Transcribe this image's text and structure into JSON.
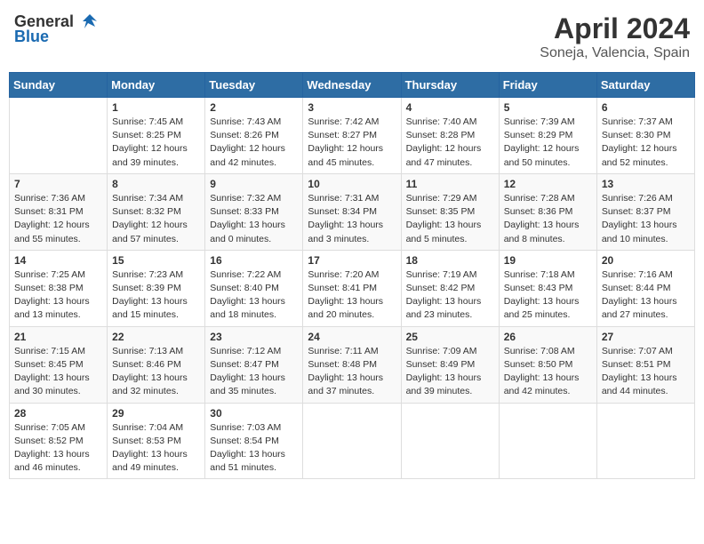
{
  "header": {
    "logo_general": "General",
    "logo_blue": "Blue",
    "month_title": "April 2024",
    "subtitle": "Soneja, Valencia, Spain"
  },
  "days_of_week": [
    "Sunday",
    "Monday",
    "Tuesday",
    "Wednesday",
    "Thursday",
    "Friday",
    "Saturday"
  ],
  "weeks": [
    [
      {
        "day": "",
        "sunrise": "",
        "sunset": "",
        "daylight": ""
      },
      {
        "day": "1",
        "sunrise": "Sunrise: 7:45 AM",
        "sunset": "Sunset: 8:25 PM",
        "daylight": "Daylight: 12 hours and 39 minutes."
      },
      {
        "day": "2",
        "sunrise": "Sunrise: 7:43 AM",
        "sunset": "Sunset: 8:26 PM",
        "daylight": "Daylight: 12 hours and 42 minutes."
      },
      {
        "day": "3",
        "sunrise": "Sunrise: 7:42 AM",
        "sunset": "Sunset: 8:27 PM",
        "daylight": "Daylight: 12 hours and 45 minutes."
      },
      {
        "day": "4",
        "sunrise": "Sunrise: 7:40 AM",
        "sunset": "Sunset: 8:28 PM",
        "daylight": "Daylight: 12 hours and 47 minutes."
      },
      {
        "day": "5",
        "sunrise": "Sunrise: 7:39 AM",
        "sunset": "Sunset: 8:29 PM",
        "daylight": "Daylight: 12 hours and 50 minutes."
      },
      {
        "day": "6",
        "sunrise": "Sunrise: 7:37 AM",
        "sunset": "Sunset: 8:30 PM",
        "daylight": "Daylight: 12 hours and 52 minutes."
      }
    ],
    [
      {
        "day": "7",
        "sunrise": "Sunrise: 7:36 AM",
        "sunset": "Sunset: 8:31 PM",
        "daylight": "Daylight: 12 hours and 55 minutes."
      },
      {
        "day": "8",
        "sunrise": "Sunrise: 7:34 AM",
        "sunset": "Sunset: 8:32 PM",
        "daylight": "Daylight: 12 hours and 57 minutes."
      },
      {
        "day": "9",
        "sunrise": "Sunrise: 7:32 AM",
        "sunset": "Sunset: 8:33 PM",
        "daylight": "Daylight: 13 hours and 0 minutes."
      },
      {
        "day": "10",
        "sunrise": "Sunrise: 7:31 AM",
        "sunset": "Sunset: 8:34 PM",
        "daylight": "Daylight: 13 hours and 3 minutes."
      },
      {
        "day": "11",
        "sunrise": "Sunrise: 7:29 AM",
        "sunset": "Sunset: 8:35 PM",
        "daylight": "Daylight: 13 hours and 5 minutes."
      },
      {
        "day": "12",
        "sunrise": "Sunrise: 7:28 AM",
        "sunset": "Sunset: 8:36 PM",
        "daylight": "Daylight: 13 hours and 8 minutes."
      },
      {
        "day": "13",
        "sunrise": "Sunrise: 7:26 AM",
        "sunset": "Sunset: 8:37 PM",
        "daylight": "Daylight: 13 hours and 10 minutes."
      }
    ],
    [
      {
        "day": "14",
        "sunrise": "Sunrise: 7:25 AM",
        "sunset": "Sunset: 8:38 PM",
        "daylight": "Daylight: 13 hours and 13 minutes."
      },
      {
        "day": "15",
        "sunrise": "Sunrise: 7:23 AM",
        "sunset": "Sunset: 8:39 PM",
        "daylight": "Daylight: 13 hours and 15 minutes."
      },
      {
        "day": "16",
        "sunrise": "Sunrise: 7:22 AM",
        "sunset": "Sunset: 8:40 PM",
        "daylight": "Daylight: 13 hours and 18 minutes."
      },
      {
        "day": "17",
        "sunrise": "Sunrise: 7:20 AM",
        "sunset": "Sunset: 8:41 PM",
        "daylight": "Daylight: 13 hours and 20 minutes."
      },
      {
        "day": "18",
        "sunrise": "Sunrise: 7:19 AM",
        "sunset": "Sunset: 8:42 PM",
        "daylight": "Daylight: 13 hours and 23 minutes."
      },
      {
        "day": "19",
        "sunrise": "Sunrise: 7:18 AM",
        "sunset": "Sunset: 8:43 PM",
        "daylight": "Daylight: 13 hours and 25 minutes."
      },
      {
        "day": "20",
        "sunrise": "Sunrise: 7:16 AM",
        "sunset": "Sunset: 8:44 PM",
        "daylight": "Daylight: 13 hours and 27 minutes."
      }
    ],
    [
      {
        "day": "21",
        "sunrise": "Sunrise: 7:15 AM",
        "sunset": "Sunset: 8:45 PM",
        "daylight": "Daylight: 13 hours and 30 minutes."
      },
      {
        "day": "22",
        "sunrise": "Sunrise: 7:13 AM",
        "sunset": "Sunset: 8:46 PM",
        "daylight": "Daylight: 13 hours and 32 minutes."
      },
      {
        "day": "23",
        "sunrise": "Sunrise: 7:12 AM",
        "sunset": "Sunset: 8:47 PM",
        "daylight": "Daylight: 13 hours and 35 minutes."
      },
      {
        "day": "24",
        "sunrise": "Sunrise: 7:11 AM",
        "sunset": "Sunset: 8:48 PM",
        "daylight": "Daylight: 13 hours and 37 minutes."
      },
      {
        "day": "25",
        "sunrise": "Sunrise: 7:09 AM",
        "sunset": "Sunset: 8:49 PM",
        "daylight": "Daylight: 13 hours and 39 minutes."
      },
      {
        "day": "26",
        "sunrise": "Sunrise: 7:08 AM",
        "sunset": "Sunset: 8:50 PM",
        "daylight": "Daylight: 13 hours and 42 minutes."
      },
      {
        "day": "27",
        "sunrise": "Sunrise: 7:07 AM",
        "sunset": "Sunset: 8:51 PM",
        "daylight": "Daylight: 13 hours and 44 minutes."
      }
    ],
    [
      {
        "day": "28",
        "sunrise": "Sunrise: 7:05 AM",
        "sunset": "Sunset: 8:52 PM",
        "daylight": "Daylight: 13 hours and 46 minutes."
      },
      {
        "day": "29",
        "sunrise": "Sunrise: 7:04 AM",
        "sunset": "Sunset: 8:53 PM",
        "daylight": "Daylight: 13 hours and 49 minutes."
      },
      {
        "day": "30",
        "sunrise": "Sunrise: 7:03 AM",
        "sunset": "Sunset: 8:54 PM",
        "daylight": "Daylight: 13 hours and 51 minutes."
      },
      {
        "day": "",
        "sunrise": "",
        "sunset": "",
        "daylight": ""
      },
      {
        "day": "",
        "sunrise": "",
        "sunset": "",
        "daylight": ""
      },
      {
        "day": "",
        "sunrise": "",
        "sunset": "",
        "daylight": ""
      },
      {
        "day": "",
        "sunrise": "",
        "sunset": "",
        "daylight": ""
      }
    ]
  ]
}
